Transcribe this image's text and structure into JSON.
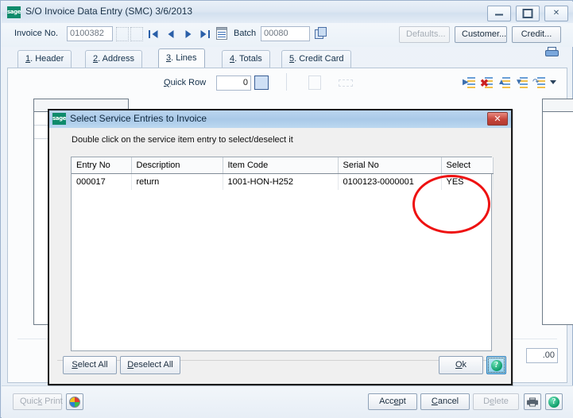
{
  "window": {
    "title": "S/O Invoice Data Entry (SMC) 3/6/2013",
    "logo_text": "sage",
    "controls": {
      "minimize": "–",
      "maximize": "□",
      "close": "✕"
    }
  },
  "toolbar": {
    "invoice_label": "Invoice No.",
    "invoice_value": "0100382",
    "batch_label": "Batch",
    "batch_value": "00080",
    "defaults_label": "Defaults...",
    "customer_label": "Customer...",
    "credit_label": "Credit..."
  },
  "tabs": [
    {
      "num": "1",
      "label": ". Header",
      "active": false
    },
    {
      "num": "2",
      "label": ". Address",
      "active": false
    },
    {
      "num": "3",
      "label": ". Lines",
      "active": true
    },
    {
      "num": "4",
      "label": ". Totals",
      "active": false
    },
    {
      "num": "5",
      "label": ". Credit Card",
      "active": false
    }
  ],
  "lines_toolbar": {
    "quick_row_label_key": "Q",
    "quick_row_label_rest": "uick Row",
    "quick_row_value": "0"
  },
  "main": {
    "amount_field": ".00"
  },
  "dialog": {
    "title": "Select Service Entries to Invoice",
    "logo_text": "sage",
    "close_label": "✕",
    "instruction": "Double click on the service item entry to select/deselect it",
    "columns": [
      "Entry No",
      "Description",
      "Item Code",
      "Serial No",
      "Select"
    ],
    "rows": [
      {
        "entry_no": "000017",
        "description": "return",
        "item_code": "1001-HON-H252",
        "serial_no": "0100123-0000001",
        "select": "YES"
      }
    ],
    "buttons": {
      "select_all_key": "S",
      "select_all_rest": "elect All",
      "deselect_all_key": "D",
      "deselect_all_rest": "eselect All",
      "ok_key": "O",
      "ok_rest": "k",
      "help_label": "?"
    }
  },
  "bottombar": {
    "quick_print_a": "Quic",
    "quick_print_key": "k",
    "quick_print_b": " Print",
    "accept_a": "Acc",
    "accept_key": "e",
    "accept_b": "pt",
    "cancel_a": "",
    "cancel_key": "C",
    "cancel_b": "ancel",
    "delete_a": "D",
    "delete_key": "e",
    "delete_b": "lete",
    "help_label": "?"
  },
  "colors": {
    "accent_red": "#ee1111",
    "sage_green": "#0f8b6c",
    "dialog_title": "#a9c9e8",
    "focus_blue": "#8fd0ee"
  }
}
